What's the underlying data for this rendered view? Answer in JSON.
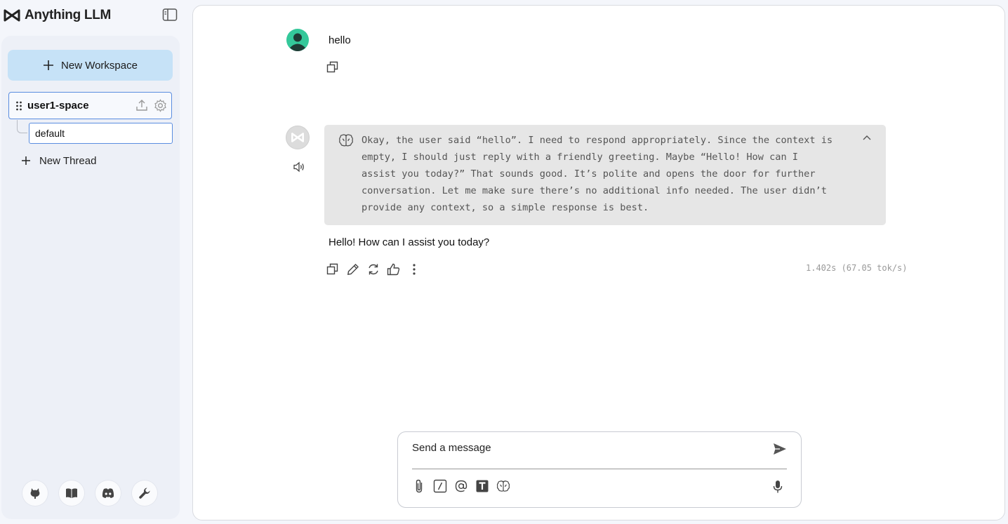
{
  "app": {
    "name": "Anything LLM"
  },
  "sidebar": {
    "new_workspace_label": "New Workspace",
    "workspace": {
      "name": "user1-space"
    },
    "thread": {
      "name": "default"
    },
    "new_thread_label": "New Thread",
    "footer_icons": [
      "github-icon",
      "docs-book-icon",
      "discord-icon",
      "settings-wrench-icon"
    ]
  },
  "chat": {
    "user_message": "hello",
    "thought": "Okay, the user said “hello”. I need to respond appropriately. Since the context is\nempty, I should just reply with a friendly greeting. Maybe “Hello! How can I\nassist you today?” That sounds good. It’s polite and opens the door for further\nconversation. Let me make sure there’s no additional info needed. The user didn’t\nprovide any context, so a simple response is best.",
    "assistant_message": "Hello! How can I assist you today?",
    "metrics": "1.402s (67.05 tok/s)"
  },
  "composer": {
    "placeholder": "Send a message"
  },
  "colors": {
    "accent": "#5a8de0",
    "new_workspace_bg": "#c6e2f7",
    "user_avatar": "#34c89a"
  }
}
